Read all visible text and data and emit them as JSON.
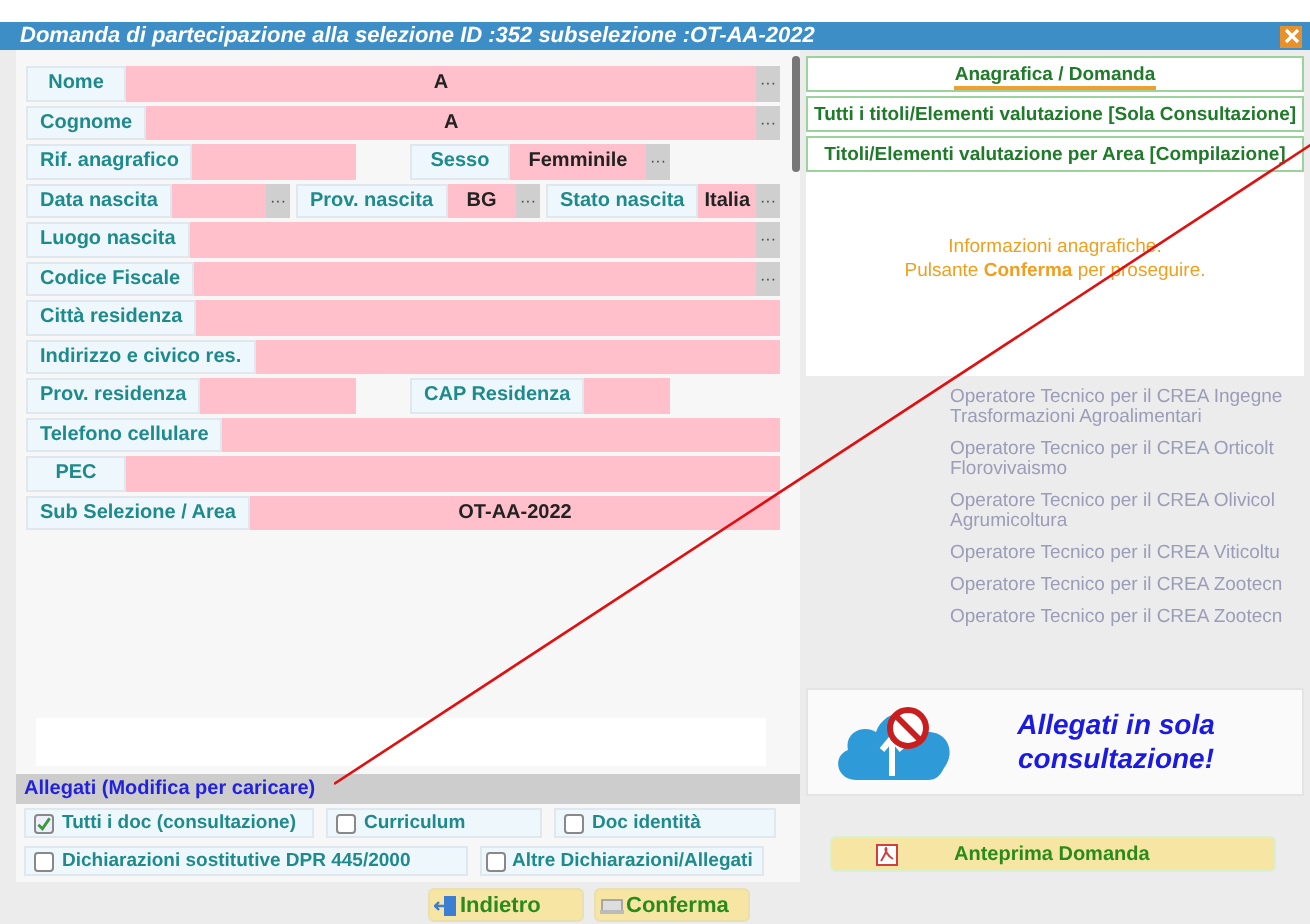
{
  "window": {
    "title": "Domanda di partecipazione alla selezione ID :352  subselezione :OT-AA-2022"
  },
  "form": {
    "rows": [
      {
        "kind": "single",
        "fields": [
          {
            "label": "Nome",
            "value": "A",
            "picker": "···"
          }
        ]
      },
      {
        "kind": "single",
        "fields": [
          {
            "label": "Cognome",
            "value": "A",
            "picker": "···"
          }
        ]
      },
      {
        "kind": "pair",
        "fields": [
          {
            "label": "Rif. anagrafico"
          },
          {
            "label": "Sesso",
            "value": "Femminile",
            "picker": "···"
          }
        ]
      },
      {
        "kind": "triple",
        "fields": [
          {
            "label": "Data nascita",
            "picker": "···"
          },
          {
            "label": "Prov. nascita",
            "value": "BG",
            "picker": "···"
          },
          {
            "label": "Stato nascita",
            "value": "Italia",
            "picker": "···"
          }
        ]
      },
      {
        "kind": "single",
        "fields": [
          {
            "label": "Luogo nascita",
            "picker": "···"
          }
        ]
      },
      {
        "kind": "single",
        "fields": [
          {
            "label": "Codice Fiscale",
            "picker": "···"
          }
        ]
      },
      {
        "kind": "single",
        "fields": [
          {
            "label": "Città  residenza"
          }
        ]
      },
      {
        "kind": "single",
        "fields": [
          {
            "label": "Indirizzo e civico res."
          }
        ]
      },
      {
        "kind": "pair",
        "fields": [
          {
            "label": "Prov. residenza"
          },
          {
            "label": "CAP Residenza"
          }
        ]
      },
      {
        "kind": "single",
        "fields": [
          {
            "label": "Telefono cellulare"
          }
        ]
      },
      {
        "kind": "single",
        "fields": [
          {
            "label": "PEC"
          }
        ]
      },
      {
        "kind": "single",
        "fields": [
          {
            "label": "Sub Selezione / Area",
            "value": "OT-AA-2022"
          }
        ]
      }
    ]
  },
  "attachments": {
    "title": "Allegati (Modifica per caricare)",
    "items": [
      {
        "label": "Tutti i doc (consultazione)",
        "checked": true
      },
      {
        "label": "Curriculum",
        "checked": false
      },
      {
        "label": "Doc identità",
        "checked": false
      },
      {
        "label": "Dichiarazioni sostitutive DPR 445/2000",
        "checked": false
      },
      {
        "label": "Altre Dichiarazioni/Allegati",
        "checked": false
      }
    ]
  },
  "buttons": [
    {
      "label": "Indietro",
      "kind": "back"
    },
    {
      "label": "Conferma",
      "kind": "confirm"
    }
  ],
  "nav": {
    "tabs": [
      {
        "label": "Anagrafica / Domanda",
        "selected": true
      },
      {
        "label": "Tutti i titoli/Elementi valutazione [Sola Consultazione]",
        "selected": false
      },
      {
        "label": "Titoli/Elementi valutazione per Area [Compilazione]",
        "selected": false
      }
    ]
  },
  "info": [
    "Informazioni anagrafiche.",
    "Pulsante **Conferma** per proseguire."
  ],
  "background_list": [
    [
      "Operatore Tecnico per il CREA Ingegne",
      "Trasformazioni Agroalimentari"
    ],
    [
      "Operatore Tecnico per il CREA Orticolt",
      "Florovivaismo"
    ],
    [
      "Operatore Tecnico per il CREA Olivicol",
      "Agrumicoltura"
    ],
    [
      "Operatore Tecnico per il CREA Viticoltu"
    ],
    [
      "Operatore Tecnico per il CREA Zootecn"
    ],
    [
      "Operatore Tecnico per il CREA Zootecn"
    ]
  ],
  "upload_notice": "Allegati in sola consultazione!",
  "preview_button": {
    "label": "Anteprima Domanda"
  }
}
